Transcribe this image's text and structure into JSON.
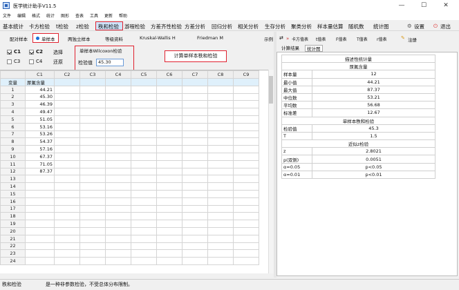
{
  "window": {
    "title": "医学统计助手V11.5",
    "min": "—",
    "max": "☐",
    "close": "✕"
  },
  "menu": [
    "文件",
    "编辑",
    "格式",
    "统计",
    "图形",
    "查表",
    "工具",
    "更新",
    "帮助"
  ],
  "toolbar": {
    "items": [
      "基本统计",
      "卡方检验",
      "t检验",
      "z检验",
      "秩和检验",
      "游程检验",
      "方差齐性检验",
      "方差分析",
      "回归分析",
      "相关分析",
      "生存分析",
      "聚类分析",
      "样本量估算",
      "随机数",
      "统计图"
    ],
    "settings": "设置",
    "exit": "退出"
  },
  "subtabs": [
    "配对样本",
    "单样本",
    "两独立样本",
    "等级资料",
    "Kruskal-Wallis H",
    "Friedman M",
    "示例"
  ],
  "controls": {
    "c1": "C1",
    "c2": "C2",
    "c3": "C3",
    "c4": "C4",
    "select": "选择",
    "restore": "还原",
    "group_title": "单样本Wilcoxon检验",
    "test_label": "检验值",
    "test_value": "45.30",
    "calc": "计算单样本秩和检验"
  },
  "grid": {
    "columns": [
      "",
      "C1",
      "C2",
      "C3",
      "C4",
      "C5",
      "C6",
      "C7",
      "C8",
      "C9"
    ],
    "var_row": "变量",
    "var_name": "尿氟含量",
    "values": [
      "44.21",
      "45.30",
      "46.39",
      "49.47",
      "51.05",
      "53.16",
      "53.26",
      "54.37",
      "57.16",
      "67.37",
      "71.05",
      "87.37"
    ],
    "row_count": 24
  },
  "right": {
    "tools": [
      "卡方值表",
      "t值表",
      "F值表",
      "T值表",
      "r值表",
      "注册"
    ],
    "tabs": [
      "计算结果",
      "统计图"
    ],
    "results": [
      {
        "type": "section",
        "label": "描述性统计量"
      },
      {
        "type": "section",
        "label": "尿氟含量"
      },
      {
        "label": "样本量",
        "value": "12"
      },
      {
        "label": "最小值",
        "value": "44.21"
      },
      {
        "label": "最大值",
        "value": "87.37"
      },
      {
        "label": "中位数",
        "value": "53.21"
      },
      {
        "label": "平均数",
        "value": "56.68"
      },
      {
        "label": "标准差",
        "value": "12.67"
      },
      {
        "type": "section",
        "label": "单样本秩和检验"
      },
      {
        "label": "检验值",
        "value": "45.3"
      },
      {
        "label": "T",
        "value": "1.5"
      },
      {
        "type": "section",
        "label": "近似z检验"
      },
      {
        "label": "z",
        "value": "2.8021"
      },
      {
        "label": "p(双侧)",
        "value": "0.0051"
      },
      {
        "label": "α=0.05",
        "value": "p<0.05"
      },
      {
        "label": "α=0.01",
        "value": "p<0.01"
      }
    ]
  },
  "status": {
    "left": "秩和检验",
    "msg": "是一种非参数检验，不受总体分布限制。"
  }
}
